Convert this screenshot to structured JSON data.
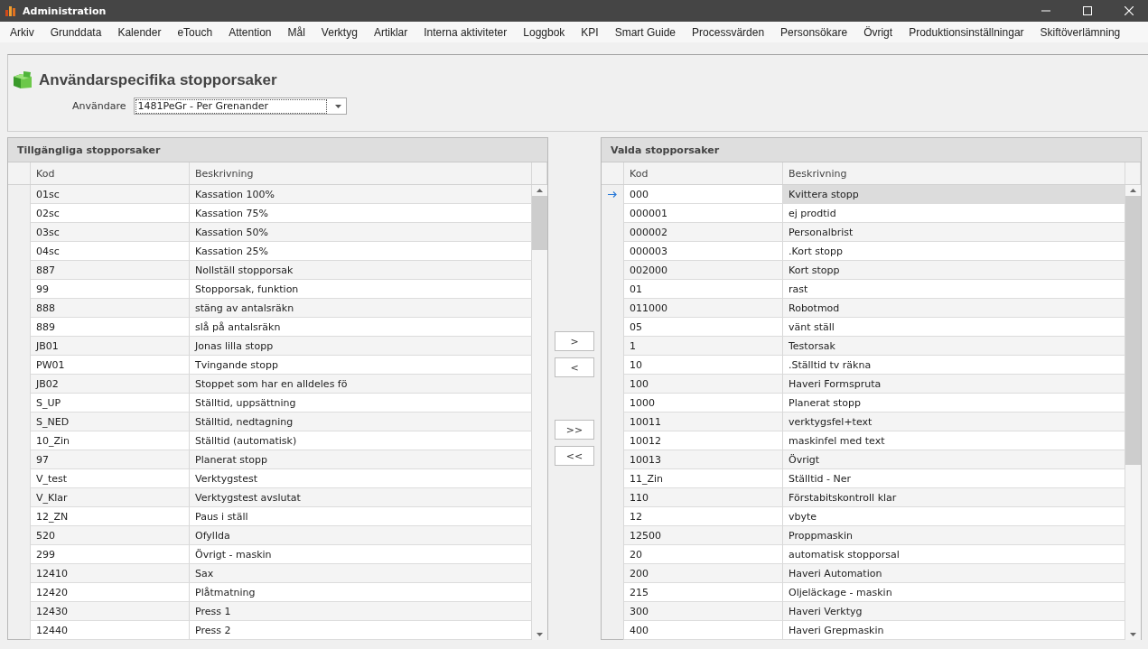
{
  "window": {
    "title": "Administration"
  },
  "menu": [
    "Arkiv",
    "Grunddata",
    "Kalender",
    "eTouch",
    "Attention",
    "Mål",
    "Verktyg",
    "Artiklar",
    "Interna aktiviteter",
    "Loggbok",
    "KPI",
    "Smart Guide",
    "Processvärden",
    "Personsökare",
    "Övrigt",
    "Produktionsinställningar",
    "Skiftöverlämning"
  ],
  "page": {
    "title": "Användarspecifika stopporsaker",
    "user_label": "Användare",
    "user_value": "1481PeGr - Per Grenander"
  },
  "available": {
    "title": "Tillgängliga stopporsaker",
    "columns": [
      "Kod",
      "Beskrivning"
    ],
    "rows": [
      {
        "code": "01sc",
        "description": "Kassation 100%",
        "selected": false
      },
      {
        "code": "02sc",
        "description": "Kassation 75%",
        "selected": false
      },
      {
        "code": "03sc",
        "description": "Kassation 50%",
        "selected": false
      },
      {
        "code": "04sc",
        "description": "Kassation 25%",
        "selected": false
      },
      {
        "code": "887",
        "description": "Nollställ stopporsak",
        "selected": false
      },
      {
        "code": "99",
        "description": "Stopporsak, funktion",
        "selected": false
      },
      {
        "code": "888",
        "description": "stäng av antalsräkn",
        "selected": false
      },
      {
        "code": "889",
        "description": "slå på antalsräkn",
        "selected": false
      },
      {
        "code": "JB01",
        "description": "Jonas lilla stopp",
        "selected": false
      },
      {
        "code": "PW01",
        "description": "Tvingande stopp",
        "selected": false
      },
      {
        "code": "JB02",
        "description": "Stoppet som har en alldeles fö",
        "selected": false
      },
      {
        "code": "S_UP",
        "description": "Ställtid, uppsättning",
        "selected": false
      },
      {
        "code": "S_NED",
        "description": "Ställtid, nedtagning",
        "selected": false
      },
      {
        "code": "10_Zin",
        "description": "Ställtid (automatisk)",
        "selected": false
      },
      {
        "code": "97",
        "description": "Planerat stopp",
        "selected": false
      },
      {
        "code": "V_test",
        "description": "Verktygstest",
        "selected": false
      },
      {
        "code": "V_Klar",
        "description": "Verktygstest avslutat",
        "selected": false
      },
      {
        "code": "12_ZN",
        "description": "Paus i ställ",
        "selected": false
      },
      {
        "code": "520",
        "description": "Ofyllda",
        "selected": false
      },
      {
        "code": "299",
        "description": "Övrigt - maskin",
        "selected": false
      },
      {
        "code": "12410",
        "description": "Sax",
        "selected": false
      },
      {
        "code": "12420",
        "description": "Plåtmatning",
        "selected": false
      },
      {
        "code": "12430",
        "description": "Press 1",
        "selected": false
      },
      {
        "code": "12440",
        "description": "Press 2",
        "selected": false
      }
    ]
  },
  "transfer_buttons": [
    ">",
    "<",
    ">>",
    "<<"
  ],
  "chosen": {
    "title": "Valda stopporsaker",
    "columns": [
      "Kod",
      "Beskrivning"
    ],
    "rows": [
      {
        "code": "000",
        "description": "Kvittera stopp",
        "selected": true
      },
      {
        "code": "000001",
        "description": "ej prodtid",
        "selected": false
      },
      {
        "code": "000002",
        "description": "Personalbrist",
        "selected": false
      },
      {
        "code": "000003",
        "description": ".Kort stopp",
        "selected": false
      },
      {
        "code": "002000",
        "description": "Kort stopp",
        "selected": false
      },
      {
        "code": "01",
        "description": "rast",
        "selected": false
      },
      {
        "code": "011000",
        "description": "Robotmod",
        "selected": false
      },
      {
        "code": "05",
        "description": "vänt ställ",
        "selected": false
      },
      {
        "code": "1",
        "description": "Testorsak",
        "selected": false
      },
      {
        "code": "10",
        "description": ".Ställtid tv räkna",
        "selected": false
      },
      {
        "code": "100",
        "description": "Haveri Formspruta",
        "selected": false
      },
      {
        "code": "1000",
        "description": "Planerat stopp",
        "selected": false
      },
      {
        "code": "10011",
        "description": "verktygsfel+text",
        "selected": false
      },
      {
        "code": "10012",
        "description": "maskinfel med text",
        "selected": false
      },
      {
        "code": "10013",
        "description": "Övrigt",
        "selected": false
      },
      {
        "code": "11_Zin",
        "description": "Ställtid - Ner",
        "selected": false
      },
      {
        "code": "110",
        "description": "Förstabitskontroll klar",
        "selected": false
      },
      {
        "code": "12",
        "description": "vbyte",
        "selected": false
      },
      {
        "code": "12500",
        "description": "Proppmaskin",
        "selected": false
      },
      {
        "code": "20",
        "description": "automatisk stopporsal",
        "selected": false
      },
      {
        "code": "200",
        "description": "Haveri Automation",
        "selected": false
      },
      {
        "code": "215",
        "description": "Oljeläckage - maskin",
        "selected": false
      },
      {
        "code": "300",
        "description": "Haveri Verktyg",
        "selected": false
      },
      {
        "code": "400",
        "description": "Haveri Grepmaskin",
        "selected": false
      }
    ]
  }
}
